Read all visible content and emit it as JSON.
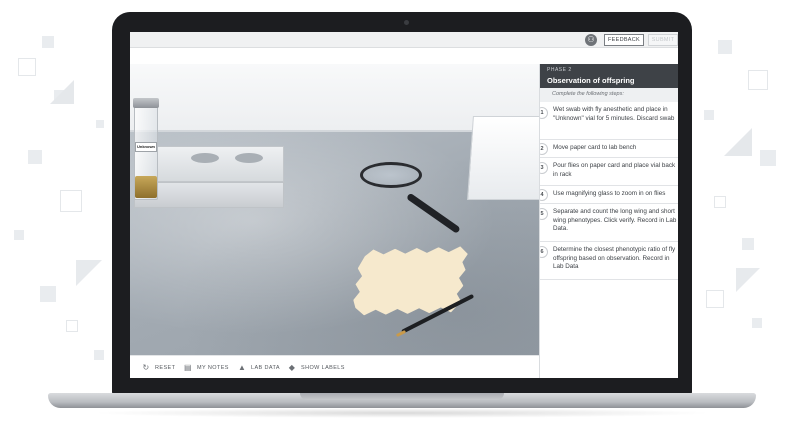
{
  "topbar": {
    "accessibility_icon": "accessibility-person-icon",
    "feedback_label": "FEEDBACK",
    "submit_label": "SUBMIT"
  },
  "scene": {
    "vial_label": "Unknown"
  },
  "toolbar": {
    "items": [
      {
        "label": "RESET",
        "icon": "reset-icon"
      },
      {
        "label": "MY NOTES",
        "icon": "notes-icon"
      },
      {
        "label": "LAB DATA",
        "icon": "flask-icon"
      },
      {
        "label": "SHOW LABELS",
        "icon": "tag-icon"
      }
    ]
  },
  "panel": {
    "phase": "PHASE 2",
    "title": "Observation of offspring",
    "subheading": "Complete the following steps:",
    "steps": [
      {
        "num": "1",
        "text": "Wet swab with fly anesthetic and place in \"Unknown\" vial for 5 minutes. Discard swab"
      },
      {
        "num": "2",
        "text": "Move paper card to lab bench"
      },
      {
        "num": "3",
        "text": "Pour flies on paper card and place vial back in rack"
      },
      {
        "num": "4",
        "text": "Use magnifying glass to zoom in on flies"
      },
      {
        "num": "5",
        "text": "Separate and count the long wing and short wing phenotypes. Click verify. Record in Lab Data."
      },
      {
        "num": "6",
        "text": "Determine the closest phenotypic ratio of fly offspring based on observation. Record in Lab Data"
      }
    ]
  },
  "colors": {
    "panel_header": "#3e4247",
    "laptop_bezel": "#1c1d20"
  }
}
